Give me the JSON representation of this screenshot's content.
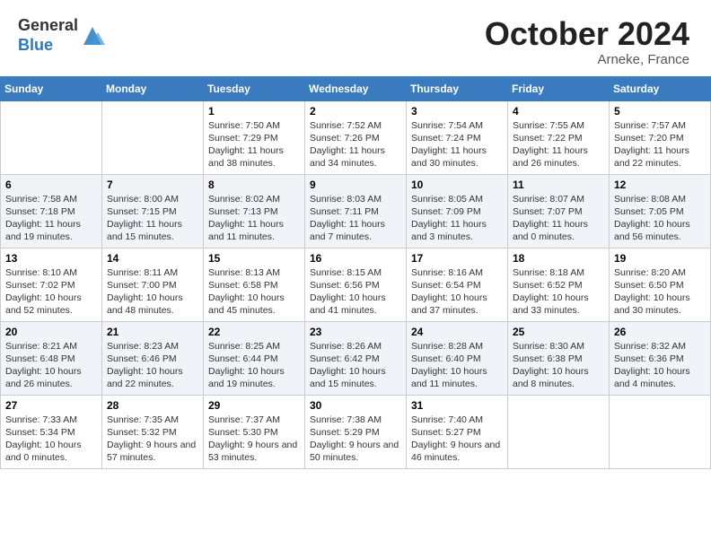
{
  "header": {
    "logo_line1": "General",
    "logo_line2": "Blue",
    "month": "October 2024",
    "location": "Arneke, France"
  },
  "days_of_week": [
    "Sunday",
    "Monday",
    "Tuesday",
    "Wednesday",
    "Thursday",
    "Friday",
    "Saturday"
  ],
  "weeks": [
    [
      {
        "day": "",
        "info": ""
      },
      {
        "day": "",
        "info": ""
      },
      {
        "day": "1",
        "info": "Sunrise: 7:50 AM\nSunset: 7:29 PM\nDaylight: 11 hours and 38 minutes."
      },
      {
        "day": "2",
        "info": "Sunrise: 7:52 AM\nSunset: 7:26 PM\nDaylight: 11 hours and 34 minutes."
      },
      {
        "day": "3",
        "info": "Sunrise: 7:54 AM\nSunset: 7:24 PM\nDaylight: 11 hours and 30 minutes."
      },
      {
        "day": "4",
        "info": "Sunrise: 7:55 AM\nSunset: 7:22 PM\nDaylight: 11 hours and 26 minutes."
      },
      {
        "day": "5",
        "info": "Sunrise: 7:57 AM\nSunset: 7:20 PM\nDaylight: 11 hours and 22 minutes."
      }
    ],
    [
      {
        "day": "6",
        "info": "Sunrise: 7:58 AM\nSunset: 7:18 PM\nDaylight: 11 hours and 19 minutes."
      },
      {
        "day": "7",
        "info": "Sunrise: 8:00 AM\nSunset: 7:15 PM\nDaylight: 11 hours and 15 minutes."
      },
      {
        "day": "8",
        "info": "Sunrise: 8:02 AM\nSunset: 7:13 PM\nDaylight: 11 hours and 11 minutes."
      },
      {
        "day": "9",
        "info": "Sunrise: 8:03 AM\nSunset: 7:11 PM\nDaylight: 11 hours and 7 minutes."
      },
      {
        "day": "10",
        "info": "Sunrise: 8:05 AM\nSunset: 7:09 PM\nDaylight: 11 hours and 3 minutes."
      },
      {
        "day": "11",
        "info": "Sunrise: 8:07 AM\nSunset: 7:07 PM\nDaylight: 11 hours and 0 minutes."
      },
      {
        "day": "12",
        "info": "Sunrise: 8:08 AM\nSunset: 7:05 PM\nDaylight: 10 hours and 56 minutes."
      }
    ],
    [
      {
        "day": "13",
        "info": "Sunrise: 8:10 AM\nSunset: 7:02 PM\nDaylight: 10 hours and 52 minutes."
      },
      {
        "day": "14",
        "info": "Sunrise: 8:11 AM\nSunset: 7:00 PM\nDaylight: 10 hours and 48 minutes."
      },
      {
        "day": "15",
        "info": "Sunrise: 8:13 AM\nSunset: 6:58 PM\nDaylight: 10 hours and 45 minutes."
      },
      {
        "day": "16",
        "info": "Sunrise: 8:15 AM\nSunset: 6:56 PM\nDaylight: 10 hours and 41 minutes."
      },
      {
        "day": "17",
        "info": "Sunrise: 8:16 AM\nSunset: 6:54 PM\nDaylight: 10 hours and 37 minutes."
      },
      {
        "day": "18",
        "info": "Sunrise: 8:18 AM\nSunset: 6:52 PM\nDaylight: 10 hours and 33 minutes."
      },
      {
        "day": "19",
        "info": "Sunrise: 8:20 AM\nSunset: 6:50 PM\nDaylight: 10 hours and 30 minutes."
      }
    ],
    [
      {
        "day": "20",
        "info": "Sunrise: 8:21 AM\nSunset: 6:48 PM\nDaylight: 10 hours and 26 minutes."
      },
      {
        "day": "21",
        "info": "Sunrise: 8:23 AM\nSunset: 6:46 PM\nDaylight: 10 hours and 22 minutes."
      },
      {
        "day": "22",
        "info": "Sunrise: 8:25 AM\nSunset: 6:44 PM\nDaylight: 10 hours and 19 minutes."
      },
      {
        "day": "23",
        "info": "Sunrise: 8:26 AM\nSunset: 6:42 PM\nDaylight: 10 hours and 15 minutes."
      },
      {
        "day": "24",
        "info": "Sunrise: 8:28 AM\nSunset: 6:40 PM\nDaylight: 10 hours and 11 minutes."
      },
      {
        "day": "25",
        "info": "Sunrise: 8:30 AM\nSunset: 6:38 PM\nDaylight: 10 hours and 8 minutes."
      },
      {
        "day": "26",
        "info": "Sunrise: 8:32 AM\nSunset: 6:36 PM\nDaylight: 10 hours and 4 minutes."
      }
    ],
    [
      {
        "day": "27",
        "info": "Sunrise: 7:33 AM\nSunset: 5:34 PM\nDaylight: 10 hours and 0 minutes."
      },
      {
        "day": "28",
        "info": "Sunrise: 7:35 AM\nSunset: 5:32 PM\nDaylight: 9 hours and 57 minutes."
      },
      {
        "day": "29",
        "info": "Sunrise: 7:37 AM\nSunset: 5:30 PM\nDaylight: 9 hours and 53 minutes."
      },
      {
        "day": "30",
        "info": "Sunrise: 7:38 AM\nSunset: 5:29 PM\nDaylight: 9 hours and 50 minutes."
      },
      {
        "day": "31",
        "info": "Sunrise: 7:40 AM\nSunset: 5:27 PM\nDaylight: 9 hours and 46 minutes."
      },
      {
        "day": "",
        "info": ""
      },
      {
        "day": "",
        "info": ""
      }
    ]
  ]
}
